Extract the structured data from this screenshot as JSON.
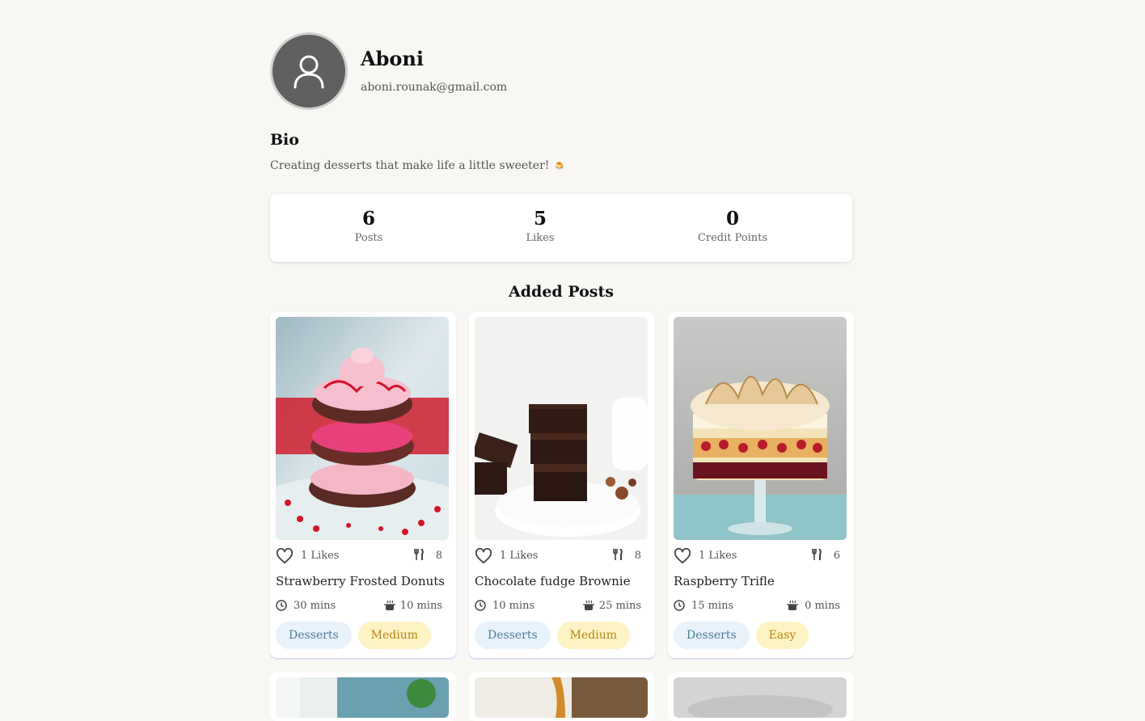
{
  "profile": {
    "name": "Aboni",
    "email": "aboni.rounak@gmail.com"
  },
  "bio": {
    "heading": "Bio",
    "text": "Creating desserts that make life a little sweeter!",
    "emoji": "🍮"
  },
  "stats": [
    {
      "value": "6",
      "label": "Posts"
    },
    {
      "value": "5",
      "label": "Likes"
    },
    {
      "value": "0",
      "label": "Credit Points"
    }
  ],
  "section_title": "Added Posts",
  "posts": [
    {
      "title": "Strawberry Frosted Donuts",
      "likes": "1 Likes",
      "servings": "8",
      "prep": "30 mins",
      "cook": "10 mins",
      "category": "Desserts",
      "difficulty": "Medium"
    },
    {
      "title": "Chocolate fudge Brownie",
      "likes": "1 Likes",
      "servings": "8",
      "prep": "10 mins",
      "cook": "25 mins",
      "category": "Desserts",
      "difficulty": "Medium"
    },
    {
      "title": "Raspberry Trifle",
      "likes": "1 Likes",
      "servings": "6",
      "prep": "15 mins",
      "cook": "0 mins",
      "category": "Desserts",
      "difficulty": "Easy"
    }
  ],
  "icons": {
    "avatar": "user-icon",
    "like": "heart-icon",
    "servings": "fork-knife-icon",
    "prep": "clock-icon",
    "cook": "cooking-pot-icon"
  }
}
